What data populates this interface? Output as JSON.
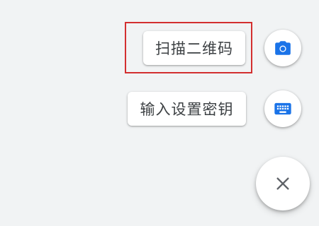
{
  "speed_dial": {
    "actions": [
      {
        "label": "扫描二维码",
        "icon": "camera-icon",
        "highlighted": true
      },
      {
        "label": "输入设置密钥",
        "icon": "keyboard-icon",
        "highlighted": false
      }
    ],
    "close_icon": "close-icon"
  },
  "colors": {
    "background": "#f1f3f4",
    "accent_blue": "#1a73e8",
    "label_text": "#3c4043",
    "close_icon": "#5f6368",
    "highlight_border": "#d32f2f"
  }
}
